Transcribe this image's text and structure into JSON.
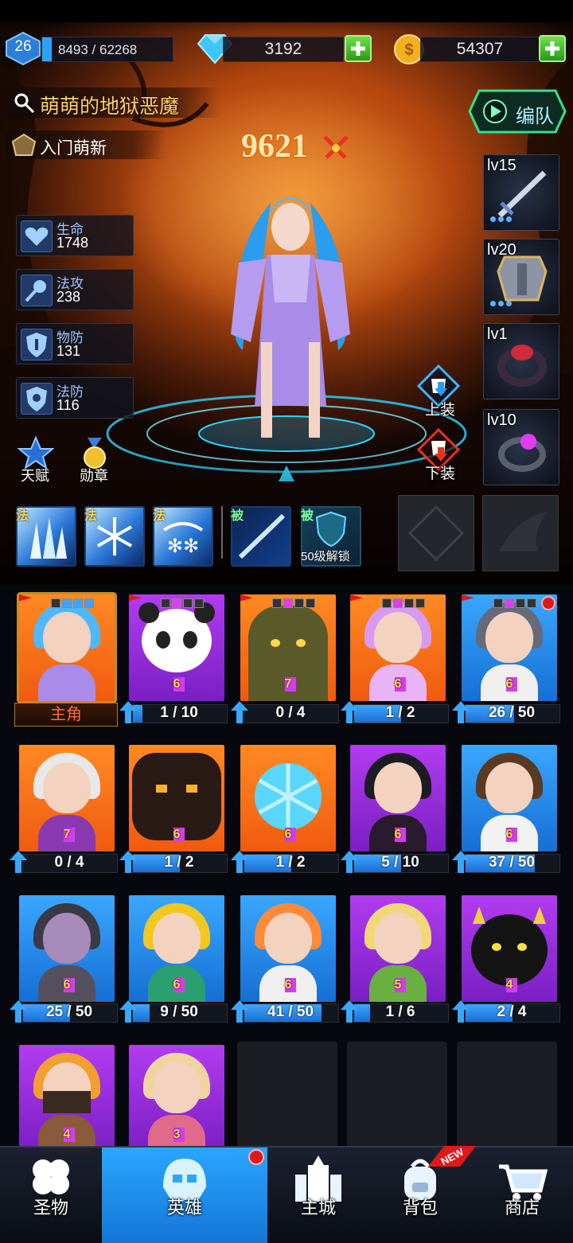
{
  "player": {
    "level": "26",
    "xp": "8493 / 62268",
    "xp_fraction": 0.136
  },
  "currency": {
    "diamonds": "3192",
    "gold": "54307"
  },
  "hero": {
    "name": "萌萌的地狱恶魔",
    "title": "入门萌新",
    "power": "9621",
    "team_button": "编队"
  },
  "stats": [
    {
      "label": "生命",
      "value": "1748",
      "icon": "heart-icon"
    },
    {
      "label": "法攻",
      "value": "238",
      "icon": "wand-icon"
    },
    {
      "label": "物防",
      "value": "131",
      "icon": "shield-icon"
    },
    {
      "label": "法防",
      "value": "116",
      "icon": "magic-shield-icon"
    }
  ],
  "equipment": [
    {
      "level": "lv15",
      "icon": "sword-icon",
      "stars": 3
    },
    {
      "level": "lv20",
      "icon": "armor-icon",
      "stars": 3
    },
    {
      "level": "lv1",
      "icon": "ring-icon",
      "stars": 0
    },
    {
      "level": "lv10",
      "icon": "amulet-icon",
      "stars": 0
    }
  ],
  "actions": {
    "talent": "天赋",
    "medal": "勋章",
    "equip_up": "上装",
    "equip_down": "下装"
  },
  "skills": [
    {
      "tag": "法",
      "icon": "ice-crystal-icon"
    },
    {
      "tag": "法",
      "icon": "snowflake-icon"
    },
    {
      "tag": "法",
      "icon": "blizzard-icon"
    },
    {
      "tag": "被",
      "icon": "light-beam-icon"
    },
    {
      "tag": "被",
      "icon": "locked-shield-icon",
      "lock_text": "50级解锁"
    }
  ],
  "roster": [
    {
      "progress": "主角",
      "stars": "",
      "bg": "orange",
      "main": true
    },
    {
      "progress": "1 / 10",
      "stars": "6",
      "bg": "purple",
      "fill": 0.1
    },
    {
      "progress": "0 / 4",
      "stars": "7",
      "bg": "orange",
      "fill": 0
    },
    {
      "progress": "1 / 2",
      "stars": "6",
      "bg": "orange",
      "fill": 0.5
    },
    {
      "progress": "26 / 50",
      "stars": "6",
      "bg": "blue",
      "fill": 0.52
    },
    {
      "progress": "0 / 4",
      "stars": "7",
      "bg": "orange",
      "fill": 0
    },
    {
      "progress": "1 / 2",
      "stars": "6",
      "bg": "orange",
      "fill": 0.5
    },
    {
      "progress": "1 / 2",
      "stars": "6",
      "bg": "orange",
      "fill": 0.5
    },
    {
      "progress": "5 / 10",
      "stars": "6",
      "bg": "purple",
      "fill": 0.5
    },
    {
      "progress": "37 / 50",
      "stars": "6",
      "bg": "blue",
      "fill": 0.74
    },
    {
      "progress": "25 / 50",
      "stars": "6",
      "bg": "blue",
      "fill": 0.5
    },
    {
      "progress": "9 / 50",
      "stars": "6",
      "bg": "blue",
      "fill": 0.18
    },
    {
      "progress": "41 / 50",
      "stars": "6",
      "bg": "blue",
      "fill": 0.82
    },
    {
      "progress": "1 / 6",
      "stars": "5",
      "bg": "purple",
      "fill": 0.17
    },
    {
      "progress": "2 / 4",
      "stars": "4",
      "bg": "purple",
      "fill": 0.5
    },
    {
      "progress": "",
      "stars": "4",
      "bg": "purple"
    },
    {
      "progress": "",
      "stars": "3",
      "bg": "purple"
    }
  ],
  "nav": [
    {
      "label": "圣物",
      "icon": "clover-icon"
    },
    {
      "label": "英雄",
      "icon": "helmet-icon",
      "active": true
    },
    {
      "label": "主城",
      "icon": "castle-icon"
    },
    {
      "label": "背包",
      "icon": "backpack-icon",
      "badge": "NEW"
    },
    {
      "label": "商店",
      "icon": "cart-icon"
    }
  ]
}
